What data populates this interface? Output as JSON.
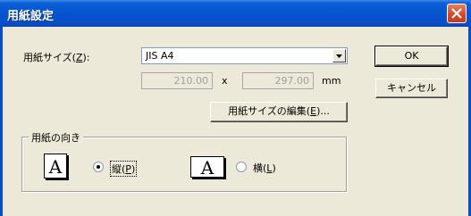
{
  "window": {
    "title": "用紙設定"
  },
  "paper_size": {
    "label_prefix": "用紙サイズ(",
    "label_key": "Z",
    "label_suffix": "):",
    "selected": "JIS A4"
  },
  "dimensions": {
    "width": "210.00",
    "separator": "x",
    "height": "297.00",
    "unit": "mm"
  },
  "buttons": {
    "ok": "OK",
    "cancel": "キャンセル",
    "edit_prefix": "用紙サイズの編集(",
    "edit_key": "E",
    "edit_suffix": ")..."
  },
  "orientation": {
    "group_label": "用紙の向き",
    "icon_letter": "A",
    "portrait_prefix": "縦(",
    "portrait_key": "P",
    "portrait_suffix": ")",
    "landscape_prefix": "横(",
    "landscape_key": "L",
    "landscape_suffix": ")",
    "selected": "portrait"
  }
}
